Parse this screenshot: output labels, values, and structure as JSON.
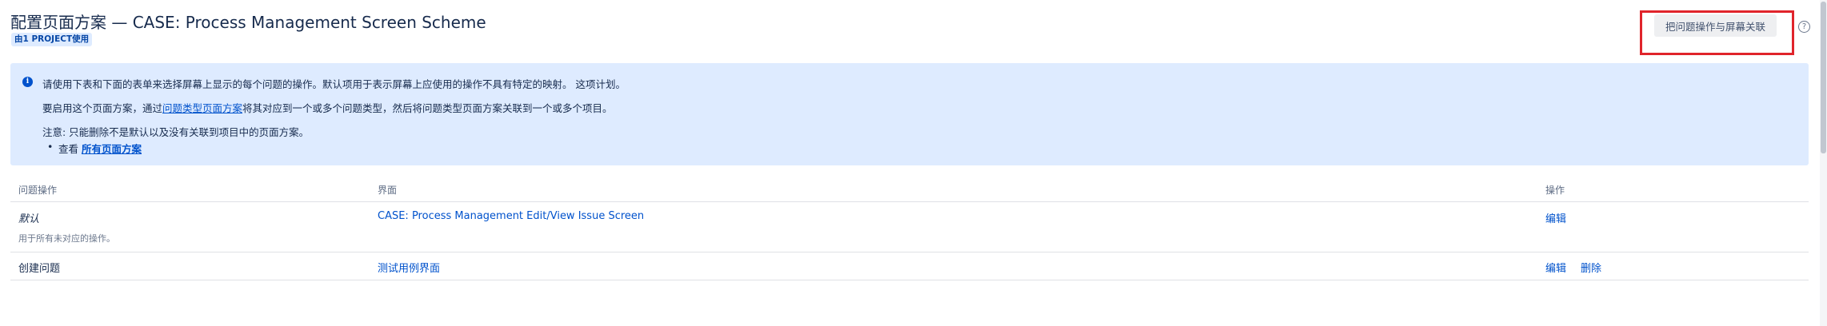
{
  "header": {
    "title": "配置页面方案 — CASE: Process Management Screen Scheme",
    "usage_badge": "由1 PROJECT使用",
    "associate_button": "把问题操作与屏幕关联",
    "help_icon": "question-circle-icon"
  },
  "info": {
    "icon": "info-icon",
    "line1": "请使用下表和下面的表单来选择屏幕上显示的每个问题的操作。默认项用于表示屏幕上应使用的操作不具有特定的映射。 这项计划。",
    "line2_prefix": "要启用这个页面方案，通过",
    "line2_link": "问题类型页面方案",
    "line2_suffix": "将其对应到一个或多个问题类型，然后将问题类型页面方案关联到一个或多个项目。",
    "line3": "注意: 只能删除不是默认以及没有关联到项目中的页面方案。",
    "bullet_prefix": "查看 ",
    "bullet_link": "所有页面方案"
  },
  "table": {
    "headers": {
      "operation": "问题操作",
      "screen": "界面",
      "actions": "操作"
    },
    "rows": [
      {
        "operation": "默认",
        "description": "用于所有未对应的操作。",
        "screen": "CASE: Process Management Edit/View Issue Screen",
        "edit": "编辑"
      },
      {
        "operation": "创建问题",
        "screen": "测试用例界面",
        "edit": "编辑",
        "delete": "删除"
      }
    ]
  },
  "colors": {
    "accent": "#0052cc",
    "info_background": "#deebff",
    "highlight": "#e0242b"
  }
}
